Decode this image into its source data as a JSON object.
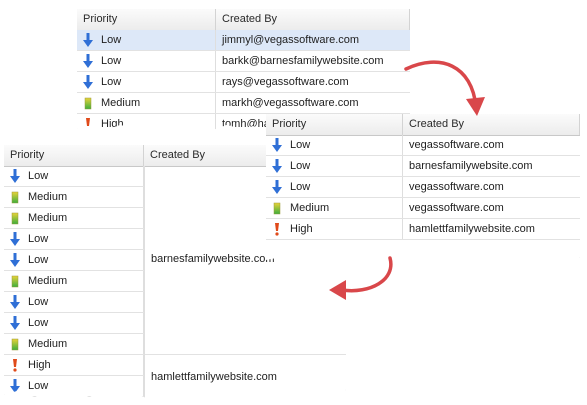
{
  "grid1": {
    "headers": {
      "priority": "Priority",
      "created_by": "Created By"
    },
    "rows": [
      {
        "priority": "Low",
        "icon": "arrow-down-icon",
        "created_by": "jimmyl@vegassoftware.com",
        "selected": true
      },
      {
        "priority": "Low",
        "icon": "arrow-down-icon",
        "created_by": "barkk@barnesfamilywebsite.com"
      },
      {
        "priority": "Low",
        "icon": "arrow-down-icon",
        "created_by": "rays@vegassoftware.com"
      },
      {
        "priority": "Medium",
        "icon": "medium-bar-icon",
        "created_by": "markh@vegassoftware.com"
      },
      {
        "priority": "High",
        "icon": "exclamation-icon",
        "created_by": "tomh@ha"
      }
    ]
  },
  "grid2": {
    "headers": {
      "priority": "Priority",
      "created_by": "Created By"
    },
    "rows": [
      {
        "priority": "Low",
        "icon": "arrow-down-icon",
        "created_by": "vegassoftware.com"
      },
      {
        "priority": "Low",
        "icon": "arrow-down-icon",
        "created_by": "barnesfamilywebsite.com"
      },
      {
        "priority": "Low",
        "icon": "arrow-down-icon",
        "created_by": "vegassoftware.com"
      },
      {
        "priority": "Medium",
        "icon": "medium-bar-icon",
        "created_by": "vegassoftware.com"
      },
      {
        "priority": "High",
        "icon": "exclamation-icon",
        "created_by": "hamlettfamilywebsite.com"
      }
    ]
  },
  "grid3": {
    "headers": {
      "priority": "Priority",
      "created_by": "Created By"
    },
    "rows": [
      {
        "priority": "Low",
        "icon": "arrow-down-icon"
      },
      {
        "priority": "Medium",
        "icon": "medium-bar-icon"
      },
      {
        "priority": "Medium",
        "icon": "medium-bar-icon"
      },
      {
        "priority": "Low",
        "icon": "arrow-down-icon"
      },
      {
        "priority": "Low",
        "icon": "arrow-down-icon"
      },
      {
        "priority": "Medium",
        "icon": "medium-bar-icon"
      },
      {
        "priority": "Low",
        "icon": "arrow-down-icon"
      },
      {
        "priority": "Low",
        "icon": "arrow-down-icon"
      },
      {
        "priority": "Medium",
        "icon": "medium-bar-icon"
      },
      {
        "priority": "High",
        "icon": "exclamation-icon"
      },
      {
        "priority": "Low",
        "icon": "arrow-down-icon"
      }
    ],
    "merged": [
      {
        "created_by": "barnesfamilywebsite.com"
      },
      {
        "created_by": "hamlettfamilywebsite.com"
      }
    ]
  },
  "colors": {
    "arrow": "#d9474a",
    "selected_row": "#dde8f8",
    "low": "#2f6fd6",
    "medium_top": "#e8d23a",
    "medium_bottom": "#3cae3c",
    "high": "#e04a1a"
  }
}
